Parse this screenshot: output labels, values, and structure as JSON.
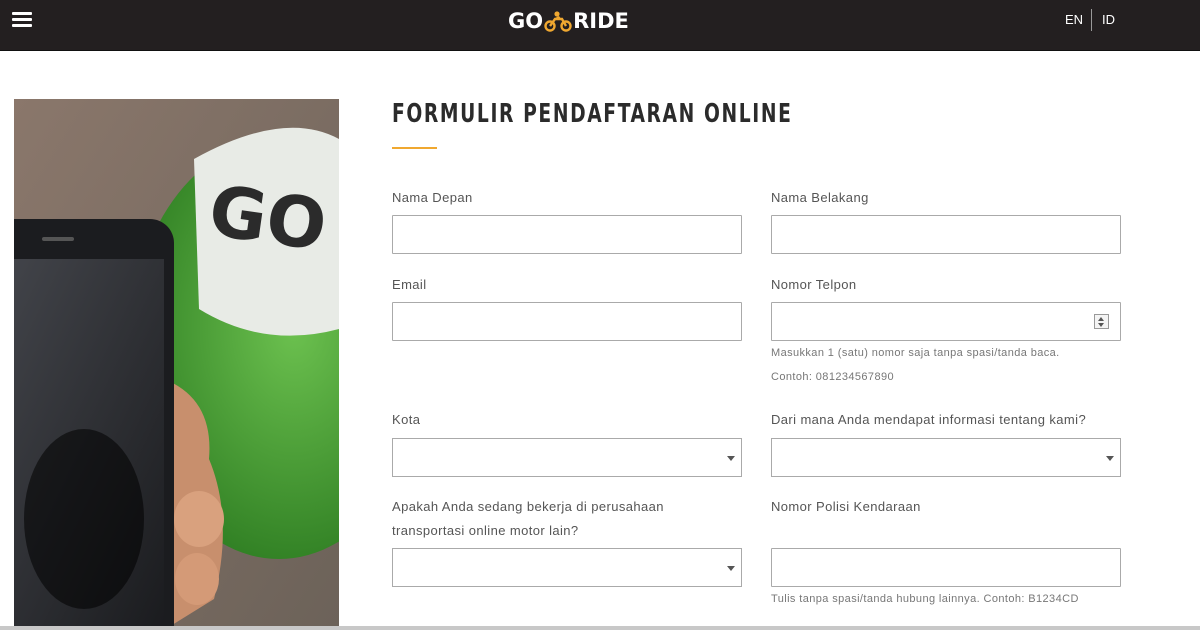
{
  "header": {
    "logo_left": "GO",
    "logo_right": "RIDE",
    "lang_en": "EN",
    "lang_id": "ID",
    "background": "#231f20",
    "logo_accent": "#f0a830"
  },
  "form": {
    "title": "FORMULIR PENDAFTARAN ONLINE",
    "accent_color": "#f0a830",
    "first_name": {
      "label": "Nama Depan",
      "value": "",
      "placeholder": ""
    },
    "last_name": {
      "label": "Nama Belakang",
      "value": "",
      "placeholder": ""
    },
    "email": {
      "label": "Email",
      "value": "",
      "placeholder": ""
    },
    "phone": {
      "label": "Nomor Telpon",
      "value": "",
      "placeholder": "",
      "help_1": "Masukkan 1 (satu) nomor saja tanpa spasi/tanda baca.",
      "help_2": "Contoh: 081234567890"
    },
    "city": {
      "label": "Kota",
      "selected": ""
    },
    "source": {
      "label": "Dari mana Anda mendapat informasi tentang kami?",
      "selected": ""
    },
    "other_company": {
      "label_line1": "Apakah Anda sedang bekerja di perusahaan",
      "label_line2": "transportasi online motor lain?",
      "selected": ""
    },
    "plate": {
      "label": "Nomor Polisi Kendaraan",
      "value": "",
      "placeholder": "",
      "help": "Tulis tanpa spasi/tanda hubung lainnya. Contoh: B1234CD"
    }
  },
  "hero_photo": {
    "helmet_text": "GO",
    "helmet_color": "#4fae3a"
  }
}
